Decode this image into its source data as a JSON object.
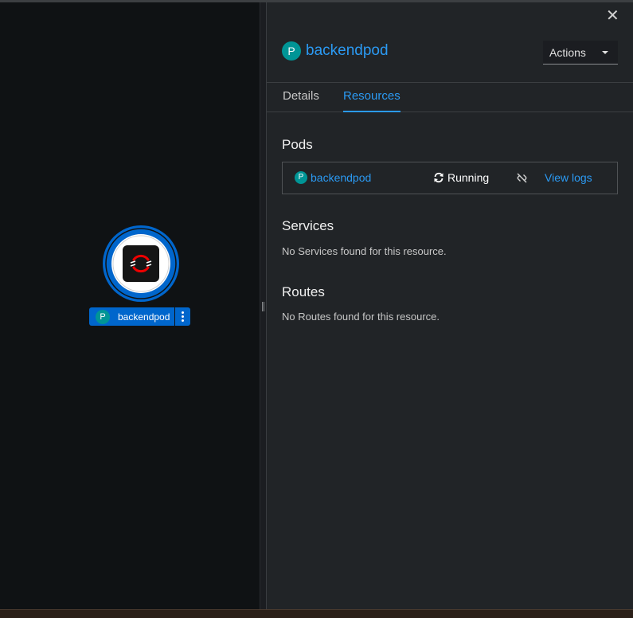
{
  "topology": {
    "node_badge": "P",
    "node_label": "backendpod"
  },
  "panel": {
    "close_icon": "close-icon",
    "title_badge": "P",
    "title": "backendpod",
    "actions_label": "Actions",
    "tabs": [
      {
        "label": "Details",
        "active": false
      },
      {
        "label": "Resources",
        "active": true
      }
    ],
    "pods": {
      "heading": "Pods",
      "items": [
        {
          "badge": "P",
          "name": "backendpod",
          "status": "Running",
          "logs_label": "View logs"
        }
      ]
    },
    "services": {
      "heading": "Services",
      "empty": "No Services found for this resource."
    },
    "routes": {
      "heading": "Routes",
      "empty": "No Routes found for this resource."
    }
  },
  "colors": {
    "link": "#2b9af3",
    "node_blue": "#0066cc",
    "pod_badge": "#009596",
    "panel_bg": "#212427",
    "canvas_bg": "#0f1214"
  }
}
